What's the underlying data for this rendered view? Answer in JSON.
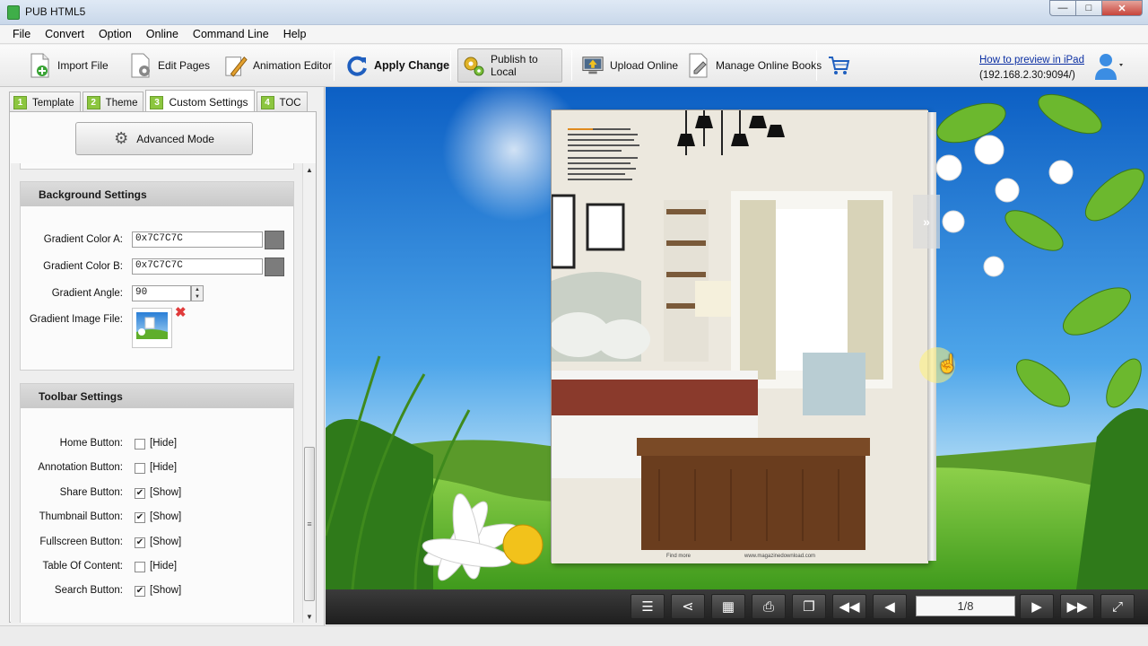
{
  "window": {
    "title": "PUB HTML5",
    "min": "—",
    "max": "□",
    "close": "✕"
  },
  "menu": [
    "File",
    "Convert",
    "Option",
    "Online",
    "Command Line",
    "Help"
  ],
  "toolbar": {
    "import": "Import File",
    "edit": "Edit Pages",
    "animation": "Animation Editor",
    "apply": "Apply Change",
    "publish": "Publish to Local",
    "upload": "Upload Online",
    "manage": "Manage Online Books",
    "preview_link": "How to preview in iPad",
    "ip": "(192.168.2.30:9094/)"
  },
  "tabs": [
    {
      "num": "1",
      "label": "Template"
    },
    {
      "num": "2",
      "label": "Theme"
    },
    {
      "num": "3",
      "label": "Custom Settings"
    },
    {
      "num": "4",
      "label": "TOC"
    }
  ],
  "advanced_mode": "Advanced Mode",
  "background": {
    "heading": "Background Settings",
    "color_a_label": "Gradient Color A:",
    "color_a": "0x7C7C7C",
    "color_b_label": "Gradient Color B:",
    "color_b": "0x7C7C7C",
    "angle_label": "Gradient Angle:",
    "angle": "90",
    "image_label": "Gradient Image File:",
    "swatch_color": "#7c7c7c"
  },
  "toolbar_settings": {
    "heading": "Toolbar Settings",
    "items": [
      {
        "label": "Home Button:",
        "checked": false,
        "state": "[Hide]"
      },
      {
        "label": "Annotation Button:",
        "checked": false,
        "state": "[Hide]"
      },
      {
        "label": "Share Button:",
        "checked": true,
        "state": "[Show]"
      },
      {
        "label": "Thumbnail Button:",
        "checked": true,
        "state": "[Show]"
      },
      {
        "label": "Fullscreen Button:",
        "checked": true,
        "state": "[Show]"
      },
      {
        "label": "Table Of Content:",
        "checked": false,
        "state": "[Hide]"
      },
      {
        "label": "Search Button:",
        "checked": true,
        "state": "[Show]"
      }
    ]
  },
  "viewer": {
    "page_indicator": "1/8",
    "caption_footer": "Find more",
    "caption_url": "www.magazinedownload.com"
  },
  "colors": {
    "accent": "#8cc63f",
    "link": "#0b2fa3",
    "viewer_bar": "#2b2b2b"
  }
}
